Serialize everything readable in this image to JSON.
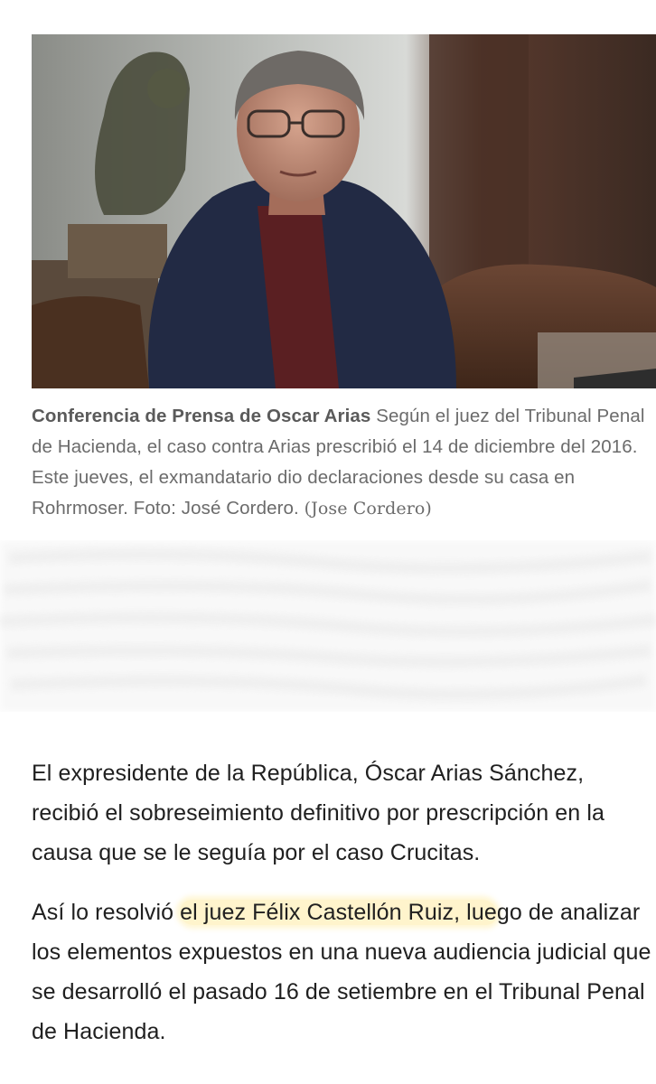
{
  "photo": {
    "icon": "portrait-photo"
  },
  "caption": {
    "title": "Conferencia de Prensa de Oscar Arias",
    "text": " Según el juez del Tribunal Penal de Hacienda, el caso contra Arias prescribió el 14 de diciembre del 2016. Este jueves, el exmandatario dio declaraciones desde su casa en Rohrmoser. Foto: José Cordero. ",
    "credit": "(Jose Cordero)"
  },
  "article": {
    "p1": "El expresidente de la República, Óscar Arias Sánchez, recibió el sobreseimiento definitivo por prescripción en la causa que se le seguía por el caso Crucitas.",
    "p2_before": "Así lo resolvió ",
    "p2_highlight": "el juez Félix Castellón Ruiz, lue",
    "p2_after": "go de analizar los elementos expuestos en una nueva audiencia judicial que se desarrolló el pasado 16 de setiembre en el Tribunal Penal de Hacienda."
  },
  "colors": {
    "highlight": "#ffe278",
    "caption_text": "#6b6b6b",
    "body_text": "#202020"
  }
}
